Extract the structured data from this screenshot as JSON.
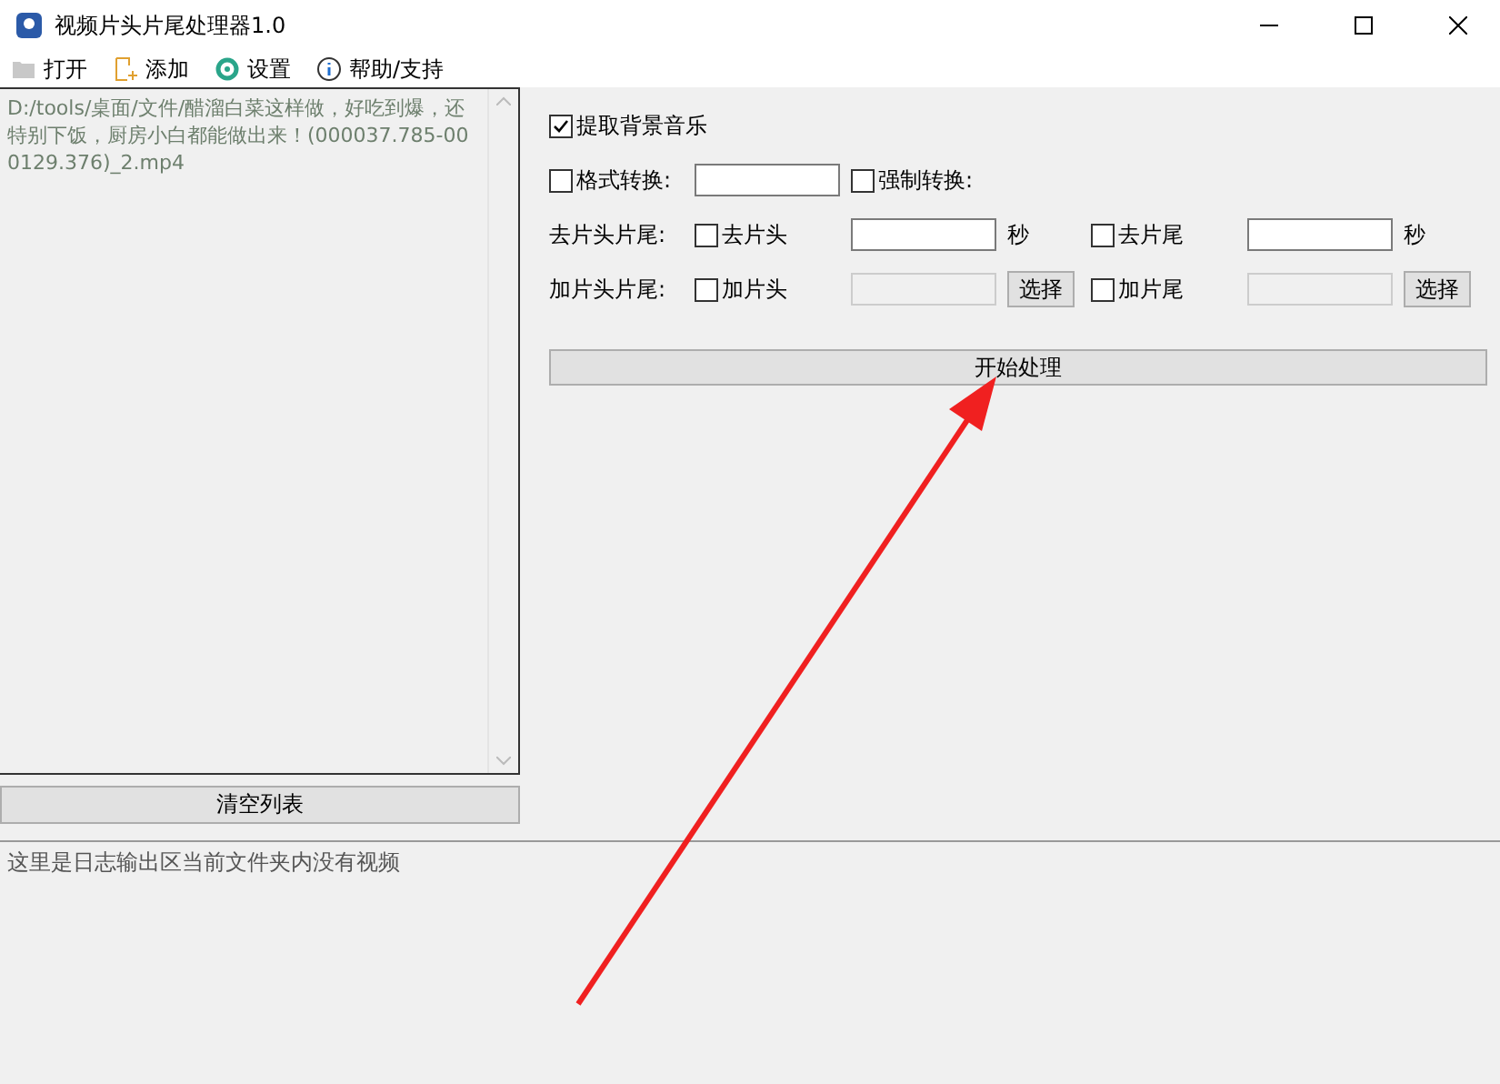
{
  "window": {
    "title": "视频片头片尾处理器1.0"
  },
  "menu": [
    {
      "label": "打开"
    },
    {
      "label": "添加"
    },
    {
      "label": "设置"
    },
    {
      "label": "帮助/支持"
    }
  ],
  "file_list": {
    "items": [
      "D:/tools/桌面/文件/醋溜白菜这样做，好吃到爆，还特别下饭，厨房小白都能做出来！(000037.785-000129.376)_2.mp4"
    ]
  },
  "clear_button": "清空列表",
  "extract_music": {
    "label": "提取背景音乐",
    "checked": true
  },
  "format_row": {
    "checkbox": {
      "label": "格式转换:",
      "checked": false
    },
    "force": {
      "label": "强制转换:",
      "checked": false
    }
  },
  "trim_row": {
    "label": "去片头片尾:",
    "head": {
      "label": "去片头",
      "checked": false,
      "unit": "秒"
    },
    "tail": {
      "label": "去片尾",
      "checked": false,
      "unit": "秒"
    }
  },
  "add_row": {
    "label": "加片头片尾:",
    "head": {
      "label": "加片头",
      "checked": false,
      "button": "选择"
    },
    "tail": {
      "label": "加片尾",
      "checked": false,
      "button": "选择"
    }
  },
  "start_button": "开始处理",
  "log": "这里是日志输出区当前文件夹内没有视频"
}
